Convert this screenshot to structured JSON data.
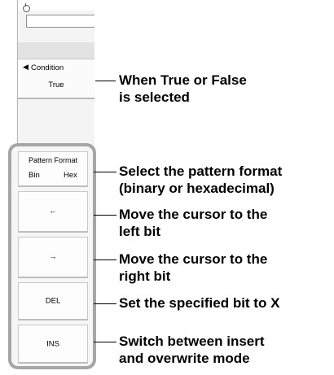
{
  "menu": {
    "condition": {
      "title": "Condition",
      "value": "True"
    },
    "softkeys": {
      "pattern_format": {
        "title": "Pattern Format",
        "options": [
          "Bin",
          "Hex"
        ]
      },
      "cursor_left": "←",
      "cursor_right": "→",
      "delete": "DEL",
      "insert": "INS"
    }
  },
  "callouts": {
    "condition": {
      "line1": "When True or False",
      "line2": "is selected"
    },
    "pattern_format": {
      "line1": "Select the pattern format",
      "line2": "(binary or hexadecimal)"
    },
    "cursor_left": {
      "line1": "Move the cursor to the",
      "line2": "left bit"
    },
    "cursor_right": {
      "line1": "Move the cursor to the",
      "line2": "right bit"
    },
    "delete": {
      "line1": "Set the specified bit to X"
    },
    "insert": {
      "line1": "Switch between insert",
      "line2": "and overwrite mode"
    }
  },
  "icons": [
    "rotary-knob-icon",
    "left-triangle-icon"
  ]
}
